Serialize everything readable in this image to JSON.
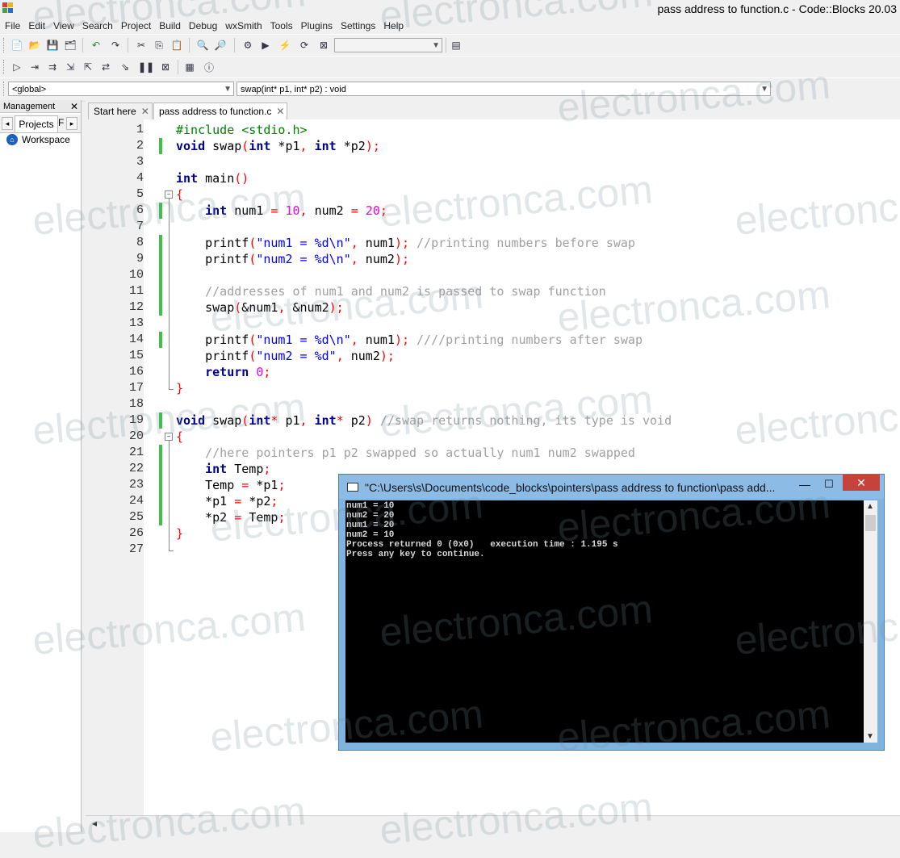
{
  "window": {
    "title": "pass address to function.c - Code::Blocks 20.03"
  },
  "menu": [
    "File",
    "Edit",
    "View",
    "Search",
    "Project",
    "Build",
    "Debug",
    "wxSmith",
    "Tools",
    "Plugins",
    "Settings",
    "Help"
  ],
  "scope_combo": {
    "value": "<global>"
  },
  "function_combo": {
    "value": "swap(int* p1, int* p2) : void"
  },
  "management": {
    "title": "Management",
    "tab": "Projects",
    "tab_partial": "F",
    "workspace": "Workspace"
  },
  "editor_tabs": [
    {
      "label": "Start here"
    },
    {
      "label": "pass address to function.c"
    }
  ],
  "code_lines": [
    "1",
    "2",
    "3",
    "4",
    "5",
    "6",
    "7",
    "8",
    "9",
    "10",
    "11",
    "12",
    "13",
    "14",
    "15",
    "16",
    "17",
    "18",
    "19",
    "20",
    "21",
    "22",
    "23",
    "24",
    "25",
    "26",
    "27"
  ],
  "code": {
    "l1_include": "#include <stdio.h>",
    "kw_void": "void",
    "kw_int": "int",
    "kw_return": "return",
    "swap_name": " swap",
    "main_name": " main",
    "p1_decl": " *p1",
    "p2_decl": " *p2",
    "num1_decl": " num1 ",
    "num2_decl": " num2 ",
    "val10": "10",
    "val20": "20",
    "val0": "0",
    "printf": "printf",
    "fmt1": "\"num1 = %d\\n\"",
    "fmt2": "\"num2 = %d\\n\"",
    "fmt2b": "\"num2 = %d\"",
    "arg_num1": " num1",
    "arg_num2": " num2",
    "c8": "//printing numbers before swap",
    "c11": "//addresses of num1 and num2 is passed to swap function",
    "swap_call": "swap",
    "amp_num1": "&num1",
    "amp_num2": " &num2",
    "c14": "////printing numbers after swap",
    "p1_def": " p1",
    "p2_def": " p2",
    "c19": "//swap returns nothing, its type is void",
    "c21": "//here pointers p1 p2 swapped so actually num1 num2 swapped",
    "temp_decl": " Temp",
    "temp": "Temp",
    "star_p1": "*p1",
    "star_p2": "*p2"
  },
  "console": {
    "title": "\"C:\\Users\\s\\Documents\\code_blocks\\pointers\\pass address to function\\pass add...",
    "lines": [
      "num1 = 10",
      "num2 = 20",
      "num1 = 20",
      "num2 = 10",
      "Process returned 0 (0x0)   execution time : 1.195 s",
      "Press any key to continue."
    ]
  },
  "watermark": "electronca.com"
}
